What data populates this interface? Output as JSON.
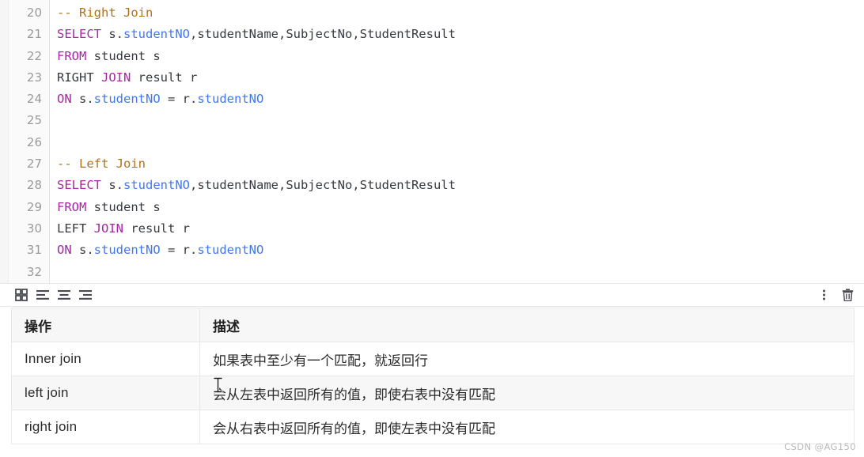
{
  "editor": {
    "lines": [
      {
        "num": "20",
        "tokens": [
          {
            "t": "-- Right Join",
            "c": "comment"
          }
        ]
      },
      {
        "num": "21",
        "tokens": [
          {
            "t": "SELECT",
            "c": "kw"
          },
          {
            "t": " s.",
            "c": "plain"
          },
          {
            "t": "studentNO",
            "c": "col"
          },
          {
            "t": ",studentName,SubjectNo,StudentResult",
            "c": "plain"
          }
        ]
      },
      {
        "num": "22",
        "tokens": [
          {
            "t": "FROM",
            "c": "kw"
          },
          {
            "t": " student s",
            "c": "plain"
          }
        ]
      },
      {
        "num": "23",
        "tokens": [
          {
            "t": "RIGHT ",
            "c": "plain"
          },
          {
            "t": "JOIN",
            "c": "kw"
          },
          {
            "t": " result r",
            "c": "plain"
          }
        ]
      },
      {
        "num": "24",
        "tokens": [
          {
            "t": "ON",
            "c": "kw"
          },
          {
            "t": " s.",
            "c": "plain"
          },
          {
            "t": "studentNO",
            "c": "col"
          },
          {
            "t": " = r.",
            "c": "plain"
          },
          {
            "t": "studentNO",
            "c": "col"
          }
        ]
      },
      {
        "num": "25",
        "tokens": []
      },
      {
        "num": "26",
        "tokens": []
      },
      {
        "num": "27",
        "tokens": [
          {
            "t": "-- Left Join",
            "c": "comment"
          }
        ]
      },
      {
        "num": "28",
        "tokens": [
          {
            "t": "SELECT",
            "c": "kw"
          },
          {
            "t": " s.",
            "c": "plain"
          },
          {
            "t": "studentNO",
            "c": "col"
          },
          {
            "t": ",studentName,SubjectNo,StudentResult",
            "c": "plain"
          }
        ]
      },
      {
        "num": "29",
        "tokens": [
          {
            "t": "FROM",
            "c": "kw"
          },
          {
            "t": " student s",
            "c": "plain"
          }
        ]
      },
      {
        "num": "30",
        "tokens": [
          {
            "t": "LEFT ",
            "c": "plain"
          },
          {
            "t": "JOIN",
            "c": "kw"
          },
          {
            "t": " result r",
            "c": "plain"
          }
        ]
      },
      {
        "num": "31",
        "tokens": [
          {
            "t": "ON",
            "c": "kw"
          },
          {
            "t": " s.",
            "c": "plain"
          },
          {
            "t": "studentNO",
            "c": "col"
          },
          {
            "t": " = r.",
            "c": "plain"
          },
          {
            "t": "studentNO",
            "c": "col"
          }
        ]
      },
      {
        "num": "32",
        "tokens": []
      }
    ],
    "syntax_colors": {
      "comment": "#b07219",
      "keyword": "#a626a4",
      "column": "#4078f2",
      "plain": "#383a42",
      "line_number": "#9a9a9a"
    }
  },
  "toolbar": {
    "left_buttons": [
      {
        "name": "table-grid-icon",
        "title": "Table"
      },
      {
        "name": "align-left-icon",
        "title": "Align left"
      },
      {
        "name": "align-center-icon",
        "title": "Align center"
      },
      {
        "name": "align-right-icon",
        "title": "Align right"
      }
    ],
    "right_buttons": [
      {
        "name": "more-options-icon",
        "title": "More"
      },
      {
        "name": "delete-trash-icon",
        "title": "Delete"
      }
    ]
  },
  "table": {
    "headers": [
      "操作",
      "描述"
    ],
    "rows": [
      {
        "operation": "Inner join",
        "description": "如果表中至少有一个匹配，就返回行"
      },
      {
        "operation": "left join",
        "description": "会从左表中返回所有的值，即使右表中没有匹配"
      },
      {
        "operation": "right join",
        "description": "会从右表中返回所有的值，即使左表中没有匹配"
      }
    ]
  },
  "watermark": {
    "text": "CSDN @AG150"
  }
}
